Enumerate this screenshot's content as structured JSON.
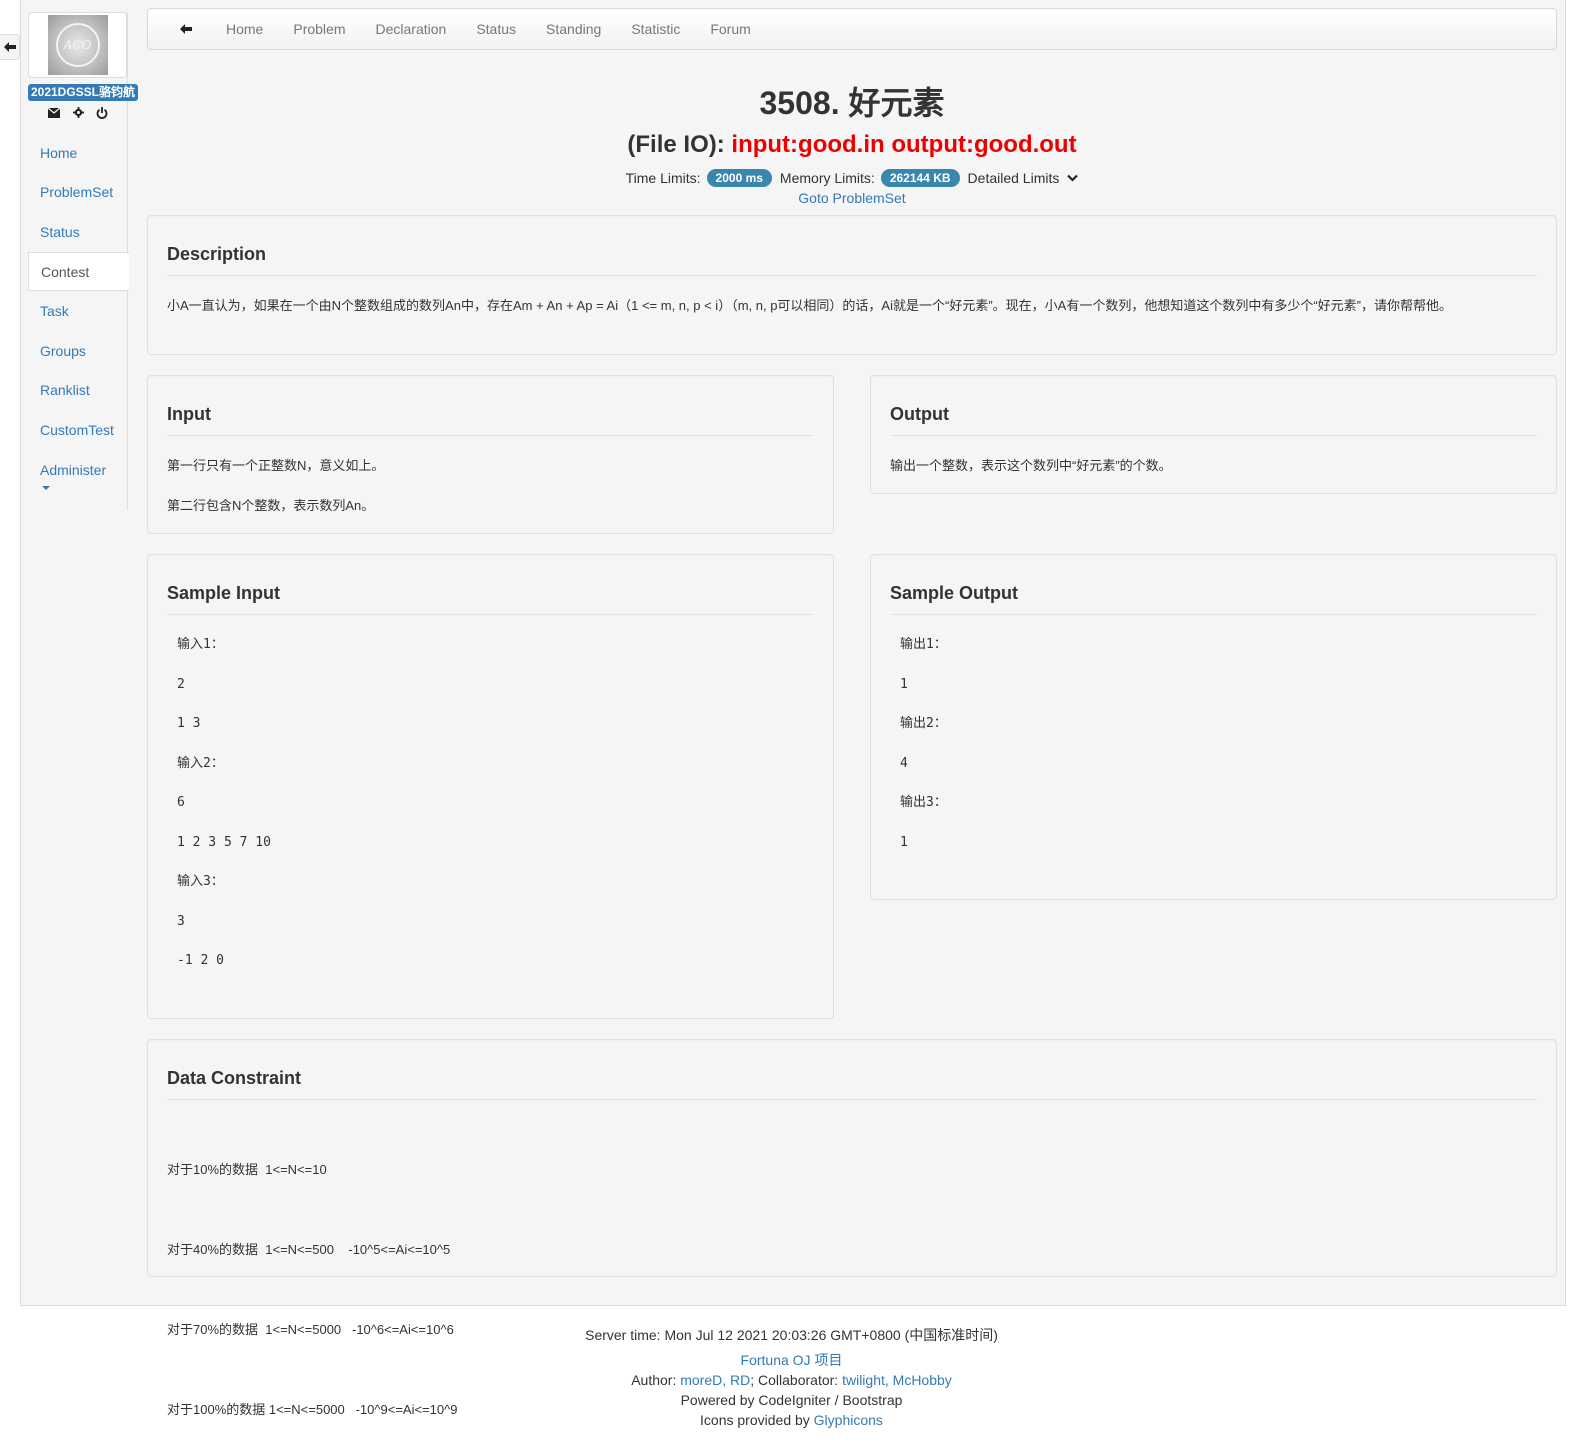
{
  "nav_top": {
    "back_icon": "arrow-left-icon",
    "tabs": [
      "Home",
      "Problem",
      "Declaration",
      "Status",
      "Standing",
      "Statistic",
      "Forum"
    ]
  },
  "sidebar": {
    "username": "2021DGSSL骆钧航",
    "icons": [
      "envelope-icon",
      "gear-icon",
      "power-icon"
    ],
    "items": [
      "Home",
      "ProblemSet",
      "Status",
      "Contest",
      "Task",
      "Groups",
      "Ranklist",
      "CustomTest",
      "Administer"
    ],
    "active": "Contest"
  },
  "problem": {
    "title": "3508. 好元素",
    "fileio_label": "(File IO): ",
    "fileio_value": "input:good.in output:good.out",
    "time_label": "Time Limits:",
    "time_value": "2000 ms",
    "memory_label": "Memory Limits:",
    "memory_value": "262144 KB",
    "detailed_label": "Detailed Limits",
    "goto": "Goto ProblemSet"
  },
  "description": {
    "heading": "Description",
    "text": "小A一直认为，如果在一个由N个整数组成的数列An中，存在Am + An + Ap = Ai（1 <= m, n, p < i）（m, n, p可以相同）的话，Ai就是一个“好元素”。现在，小A有一个数列，他想知道这个数列中有多少个“好元素”，请你帮帮他。"
  },
  "input": {
    "heading": "Input",
    "lines": [
      "第一行只有一个正整数N，意义如上。",
      "第二行包含N个整数，表示数列An。"
    ]
  },
  "output": {
    "heading": "Output",
    "lines": [
      "输出一个整数，表示这个数列中“好元素”的个数。"
    ]
  },
  "sample_input": {
    "heading": "Sample Input",
    "lines": [
      "输入1：",
      "2",
      "1 3",
      "输入2：",
      "6",
      "1 2 3 5 7 10",
      "输入3：",
      "3",
      "-1 2 0"
    ]
  },
  "sample_output": {
    "heading": "Sample Output",
    "lines": [
      "输出1：",
      "1",
      "输出2：",
      "4",
      "输出3：",
      "1"
    ]
  },
  "constraint": {
    "heading": "Data Constraint",
    "lines": [
      "对于10%的数据  1<=N<=10",
      "对于40%的数据  1<=N<=500    -10^5<=Ai<=10^5",
      "对于70%的数据  1<=N<=5000   -10^6<=Ai<=10^6",
      "对于100%的数据 1<=N<=5000   -10^9<=Ai<=10^9"
    ]
  },
  "footer": {
    "server_time": "Server time: Mon Jul 12 2021 20:03:26 GMT+0800 (中国标准时间)",
    "project_link": "Fortuna OJ 项目",
    "author_label": "Author: ",
    "author_links": "moreD, RD",
    "collab_label": "; Collaborator: ",
    "collab_links": "twilight, McHobby",
    "powered": "Powered by CodeIgniter / Bootstrap",
    "icons_label": "Icons provided by ",
    "icons_link": "Glyphicons"
  },
  "colors": {
    "link": "#337ab7",
    "fileio_red": "#ee0000",
    "badge": "#3a87ad"
  }
}
